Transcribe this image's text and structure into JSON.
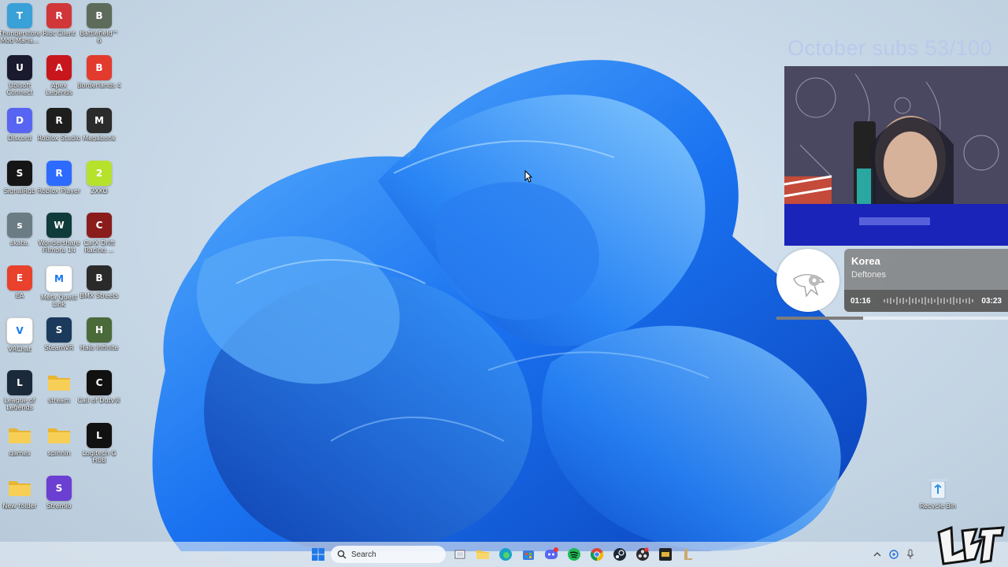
{
  "desktop": {
    "icons": [
      {
        "label": "Thunderstore Mod Mana...",
        "icon": "thunderstore-icon",
        "color": "#3aa0d8"
      },
      {
        "label": "Riot Client",
        "icon": "riot-client-icon",
        "color": "#d13639"
      },
      {
        "label": "Battlefield™ 6",
        "icon": "battlefield-icon",
        "color": "#5d6b5a"
      },
      {
        "label": "Ubisoft Connect",
        "icon": "ubisoft-icon",
        "color": "#1a1a2e"
      },
      {
        "label": "Apex Legends",
        "icon": "apex-icon",
        "color": "#c8161d"
      },
      {
        "label": "Borderlands 4",
        "icon": "borderlands-icon",
        "color": "#e23b2e"
      },
      {
        "label": "Discord",
        "icon": "discord-icon",
        "color": "#5865f2"
      },
      {
        "label": "Roblox Studio",
        "icon": "roblox-studio-icon",
        "color": "#1e1e1e"
      },
      {
        "label": "Megabonk",
        "icon": "megabonk-icon",
        "color": "#2b2b2b"
      },
      {
        "label": "SignalRgb",
        "icon": "signalrgb-icon",
        "color": "#151515"
      },
      {
        "label": "Roblox Player",
        "icon": "roblox-player-icon",
        "color": "#2d6bff"
      },
      {
        "label": "2XKO",
        "icon": "2xko-icon",
        "color": "#b7e22c"
      },
      {
        "label": "skate.",
        "icon": "skate-icon",
        "color": "#6b7c85"
      },
      {
        "label": "Wondershare Filmora 14",
        "icon": "filmora-icon",
        "color": "#0f3b3a"
      },
      {
        "label": "CarX Drift Racing ...",
        "icon": "carx-icon",
        "color": "#8a1c1c"
      },
      {
        "label": "EA",
        "icon": "ea-icon",
        "color": "#e8412c"
      },
      {
        "label": "Meta Quest Link",
        "icon": "meta-quest-icon",
        "color": "#ffffff"
      },
      {
        "label": "BMX Streets",
        "icon": "bmx-streets-icon",
        "color": "#2a2a2a"
      },
      {
        "label": "VRChat",
        "icon": "vrchat-icon",
        "color": "#ffffff"
      },
      {
        "label": "SteamVR",
        "icon": "steamvr-icon",
        "color": "#1b3a5c"
      },
      {
        "label": "Halo Infinite",
        "icon": "halo-icon",
        "color": "#4a6a3a"
      },
      {
        "label": "League of Legends",
        "icon": "league-icon",
        "color": "#1a2a3a"
      },
      {
        "label": "stream",
        "icon": "folder-icon",
        "color": "#f5c342"
      },
      {
        "label": "Call of Duty®",
        "icon": "cod-icon",
        "color": "#111111"
      },
      {
        "label": "games",
        "icon": "folder-icon",
        "color": "#f5c342"
      },
      {
        "label": "spinnin",
        "icon": "folder-icon",
        "color": "#f5c342"
      },
      {
        "label": "Logitech G HUB",
        "icon": "ghub-icon",
        "color": "#111111"
      },
      {
        "label": "New folder",
        "icon": "folder-icon",
        "color": "#f5c342"
      },
      {
        "label": "Stremio",
        "icon": "stremio-icon",
        "color": "#6b3fd1"
      }
    ],
    "recycle_bin": {
      "label": "Recycle Bin",
      "icon": "recycle-bin-icon"
    }
  },
  "overlay": {
    "subs_goal": "October subs 53/100",
    "music": {
      "title": "Korea",
      "artist": "Deftones",
      "elapsed": "01:16",
      "total": "03:23",
      "progress": 0.375
    }
  },
  "taskbar": {
    "search_label": "Search",
    "apps": [
      {
        "name": "start-icon"
      },
      {
        "name": "task-view-icon"
      },
      {
        "name": "file-explorer-icon"
      },
      {
        "name": "edge-icon"
      },
      {
        "name": "store-icon"
      },
      {
        "name": "discord-taskbar-icon"
      },
      {
        "name": "spotify-icon"
      },
      {
        "name": "chrome-icon"
      },
      {
        "name": "steam-icon"
      },
      {
        "name": "obs-icon"
      },
      {
        "name": "megabonk-taskbar-icon"
      },
      {
        "name": "league-taskbar-icon"
      }
    ]
  },
  "colors": {
    "accent": "#1f6fe8",
    "taskbar": "#e4ecf4"
  }
}
